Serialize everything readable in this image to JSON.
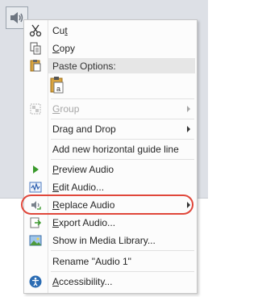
{
  "menu": {
    "cut_label": "Cut",
    "cut_key": "t",
    "copy_label": "Copy",
    "copy_key": "C",
    "paste_header": "Paste Options:",
    "group_label": "Group",
    "group_key": "G",
    "drag_drop_label": "Drag and Drop",
    "guide_label": "Add new horizontal guide line",
    "preview_label": "Preview Audio",
    "preview_key": "P",
    "edit_label": "Edit Audio...",
    "edit_key": "E",
    "replace_label": "Replace Audio",
    "replace_key": "R",
    "export_label": "Export Audio...",
    "export_key": "E",
    "media_library_label": "Show in Media Library...",
    "rename_label": "Rename \"Audio 1\"",
    "accessibility_label": "Accessibility...",
    "accessibility_key": "A"
  },
  "colors": {
    "highlight_ring": "#e0473b",
    "play_green": "#3a9a2c",
    "accessibility_blue": "#2b6cb3"
  }
}
